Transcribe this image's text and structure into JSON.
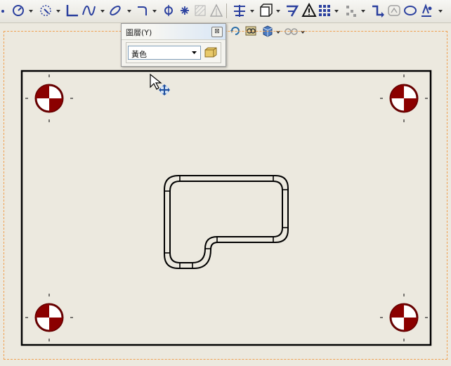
{
  "toolbar": {
    "icons": [
      "circle-center-icon",
      "circle-3pt-icon",
      "line-icon",
      "curve-icon",
      "ellipse-icon",
      "fillet-icon",
      "point-icon",
      "asterisk-icon",
      "hatch-icon",
      "text-icon",
      "align-icon",
      "box-icon",
      "shape-7-icon",
      "warning-icon",
      "grid-icon",
      "dots-icon",
      "connector-icon",
      "bracket-icon",
      "oval-icon",
      "measure-icon"
    ],
    "secondary_icons": [
      "refresh-icon",
      "glasses-group-icon",
      "cube-icon",
      "view-glasses-icon"
    ]
  },
  "layer_panel": {
    "title": "圖層(Y)",
    "close_label": "⊠",
    "layer_value": "黃色"
  },
  "colors": {
    "background": "#ece9df",
    "frame_dash": "#f0a050",
    "part_outline": "#000000",
    "hole_fill": "#8b0000",
    "toolbar_icon": "#2a3f9e"
  }
}
